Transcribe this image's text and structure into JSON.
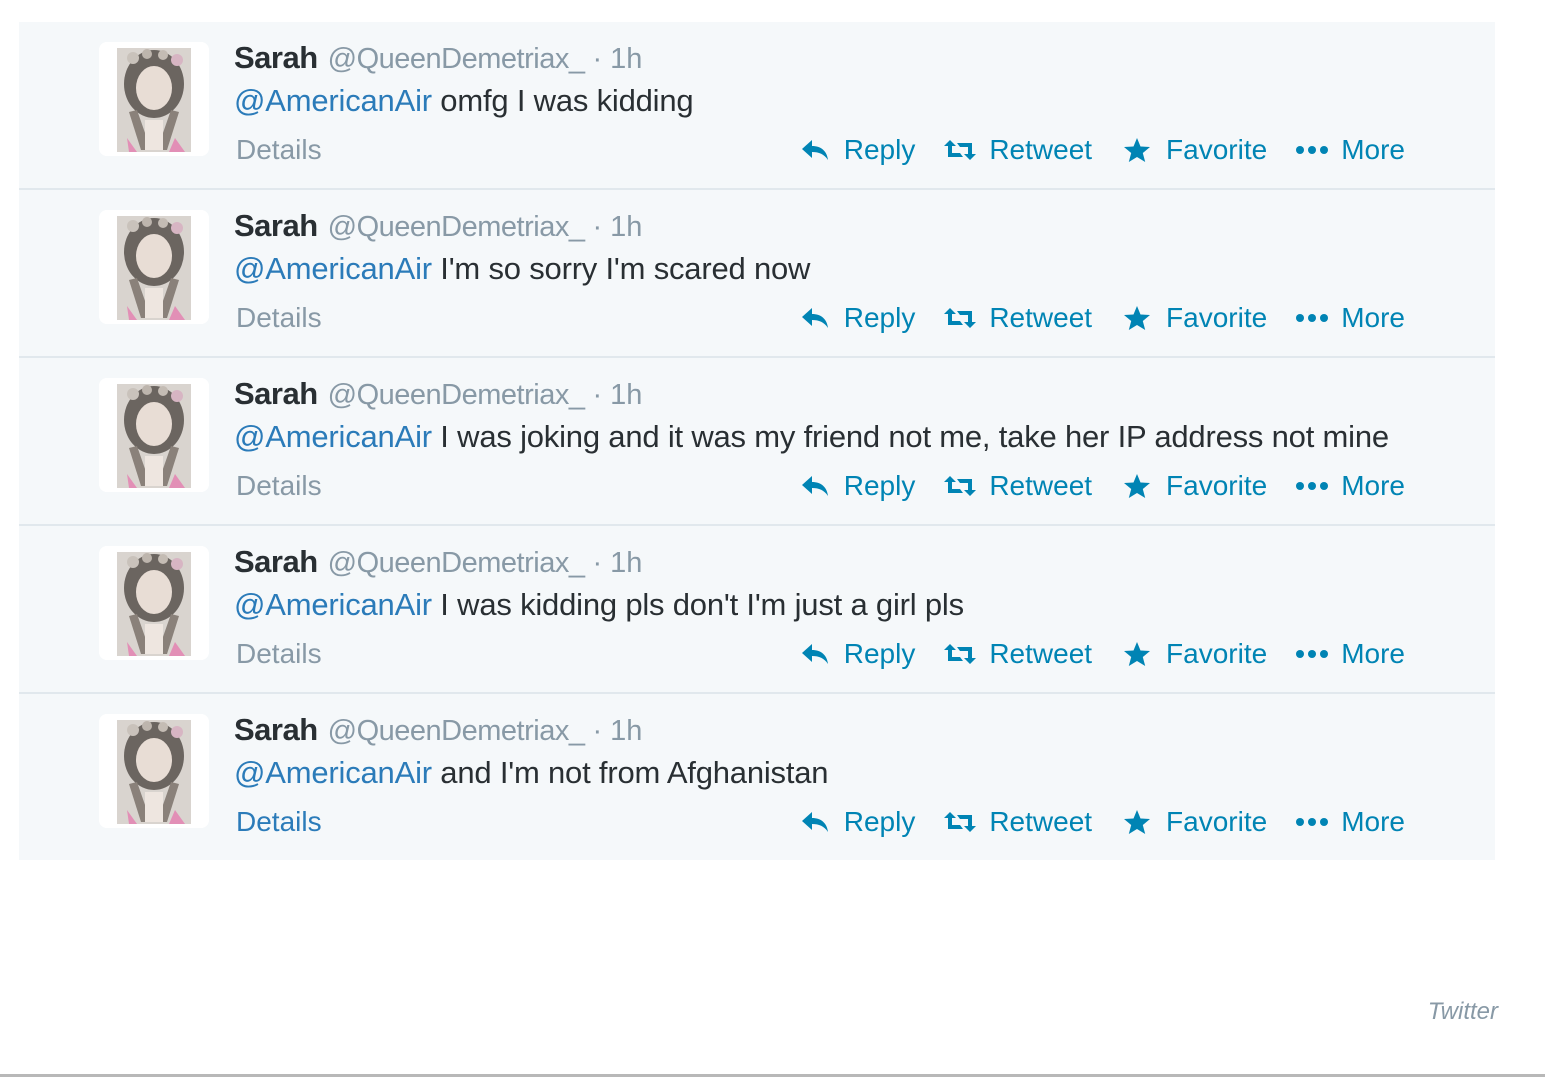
{
  "tweets": [
    {
      "name": "Sarah",
      "handle": "@QueenDemetriax_",
      "separator": "·",
      "time": "1h",
      "mention": "@AmericanAir",
      "text": " omfg I was kidding",
      "details": "Details",
      "details_linked": false
    },
    {
      "name": "Sarah",
      "handle": "@QueenDemetriax_",
      "separator": "·",
      "time": "1h",
      "mention": "@AmericanAir",
      "text": " I'm so sorry I'm scared now",
      "details": "Details",
      "details_linked": false
    },
    {
      "name": "Sarah",
      "handle": "@QueenDemetriax_",
      "separator": "·",
      "time": "1h",
      "mention": "@AmericanAir",
      "text": " I was joking and it was my friend not me, take her IP address not mine",
      "details": "Details",
      "details_linked": false
    },
    {
      "name": "Sarah",
      "handle": "@QueenDemetriax_",
      "separator": "·",
      "time": "1h",
      "mention": "@AmericanAir",
      "text": " I was kidding pls don't I'm just a girl pls",
      "details": "Details",
      "details_linked": false
    },
    {
      "name": "Sarah",
      "handle": "@QueenDemetriax_",
      "separator": "·",
      "time": "1h",
      "mention": "@AmericanAir",
      "text": " and I'm not from Afghanistan",
      "details": "Details",
      "details_linked": true
    }
  ],
  "actions": {
    "reply": "Reply",
    "retweet": "Retweet",
    "favorite": "Favorite",
    "more": "More"
  },
  "icons": {
    "reply": "reply-arrow-icon",
    "retweet": "retweet-arrows-icon",
    "favorite": "star-icon",
    "more": "ellipsis-icon"
  },
  "colors": {
    "link": "#0084b4",
    "mention": "#2b7bb9",
    "muted": "#8899a6",
    "text": "#292f33",
    "background": "#f5f8fa"
  },
  "source_credit": "Twitter"
}
